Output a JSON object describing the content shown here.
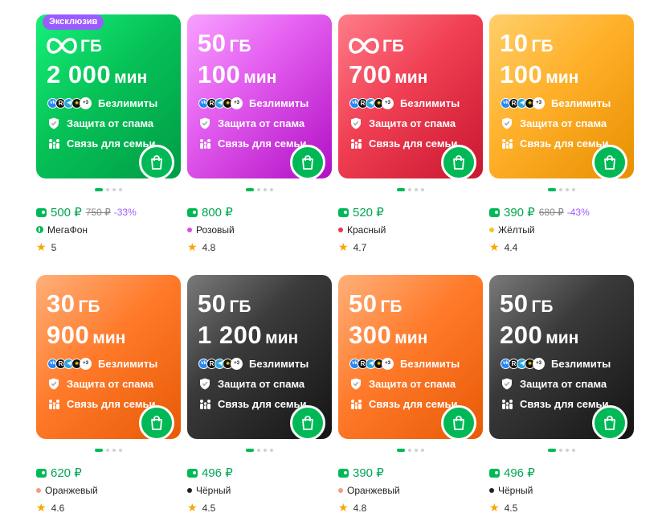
{
  "colors": {
    "accent": "#00b956",
    "discount": "#9b5cff",
    "price": "#00a650"
  },
  "products": [
    {
      "badge": "Эксклюзив",
      "gb": "∞",
      "gb_unit": "ГБ",
      "minutes": "2 000",
      "min_unit": "мин",
      "feature_apps": [
        "vk",
        "R",
        "tg",
        "ya",
        "+3"
      ],
      "features": [
        "Безлимиты",
        "Защита от спама",
        "Связь для семьи"
      ],
      "price": "500 ₽",
      "old_price": "750 ₽",
      "discount": "-33%",
      "color_name": "МегаФон",
      "color_dot": "operator-icon",
      "rating": "5",
      "gradient": "linear-gradient(135deg,#17f07a 0%,#06c257 45%,#009c46 100%)"
    },
    {
      "gb": "50",
      "gb_unit": "ГБ",
      "minutes": "100",
      "min_unit": "мин",
      "feature_apps": [
        "vk",
        "R",
        "tg",
        "ya",
        "+3"
      ],
      "features": [
        "Безлимиты",
        "Защита от спама",
        "Связь для семьи"
      ],
      "price": "800 ₽",
      "color_name": "Розовый",
      "color_dot": "#d94fd8",
      "rating": "4.8",
      "gradient": "linear-gradient(135deg,#f8a1ff 0%,#e45ff0 40%,#b10fc4 100%)"
    },
    {
      "gb": "∞",
      "gb_unit": "ГБ",
      "minutes": "700",
      "min_unit": "мин",
      "feature_apps": [
        "vk",
        "R",
        "tg",
        "ya",
        "+3"
      ],
      "features": [
        "Безлимиты",
        "Защита от спама",
        "Связь для семьи"
      ],
      "price": "520 ₽",
      "color_name": "Красный",
      "color_dot": "#e8364a",
      "rating": "4.7",
      "gradient": "linear-gradient(135deg,#ff7d8a 0%,#f03e52 45%,#c81730 100%)"
    },
    {
      "gb": "10",
      "gb_unit": "ГБ",
      "minutes": "100",
      "min_unit": "мин",
      "feature_apps": [
        "vk",
        "R",
        "tg",
        "ya",
        "+3"
      ],
      "features": [
        "Безлимиты",
        "Защита от спама",
        "Связь для семьи"
      ],
      "price": "390 ₽",
      "old_price": "680 ₽",
      "discount": "-43%",
      "color_name": "Жёлтый",
      "color_dot": "#f7c12b",
      "rating": "4.4",
      "gradient": "linear-gradient(135deg,#ffcf6a 0%,#ffb02a 45%,#e88f00 100%)"
    },
    {
      "gb": "30",
      "gb_unit": "ГБ",
      "minutes": "900",
      "min_unit": "мин",
      "feature_apps": [
        "vk",
        "R",
        "tg",
        "ya",
        "+3"
      ],
      "features": [
        "Безлимиты",
        "Защита от спама",
        "Связь для семьи"
      ],
      "price": "620 ₽",
      "color_name": "Оранжевый",
      "color_dot": "#f59c7e",
      "rating": "4.6",
      "gradient": "linear-gradient(135deg,#ffb07a 0%,#ff7a2a 45%,#e85a06 100%)"
    },
    {
      "gb": "50",
      "gb_unit": "ГБ",
      "minutes": "1 200",
      "min_unit": "мин",
      "feature_apps": [
        "vk",
        "R",
        "tg",
        "ya",
        "+3"
      ],
      "features": [
        "Безлимиты",
        "Защита от спама",
        "Связь для семьи"
      ],
      "price": "496 ₽",
      "color_name": "Чёрный",
      "color_dot": "#222222",
      "rating": "4.5",
      "gradient": "linear-gradient(135deg,#7a7a7a 0%,#3a3a3a 40%,#141414 100%)"
    },
    {
      "gb": "50",
      "gb_unit": "ГБ",
      "minutes": "300",
      "min_unit": "мин",
      "feature_apps": [
        "vk",
        "R",
        "tg",
        "ya",
        "+3"
      ],
      "features": [
        "Безлимиты",
        "Защита от спама",
        "Связь для семьи"
      ],
      "price": "390 ₽",
      "color_name": "Оранжевый",
      "color_dot": "#f59c7e",
      "rating": "4.8",
      "gradient": "linear-gradient(135deg,#ffb07a 0%,#ff7a2a 45%,#e85a06 100%)"
    },
    {
      "gb": "50",
      "gb_unit": "ГБ",
      "minutes": "200",
      "min_unit": "мин",
      "feature_apps": [
        "vk",
        "R",
        "tg",
        "ya",
        "+3"
      ],
      "features": [
        "Безлимиты",
        "Защита от спама",
        "Связь для семьи"
      ],
      "price": "496 ₽",
      "color_name": "Чёрный",
      "color_dot": "#222222",
      "rating": "4.5",
      "gradient": "linear-gradient(135deg,#7a7a7a 0%,#3a3a3a 40%,#141414 100%)"
    }
  ]
}
